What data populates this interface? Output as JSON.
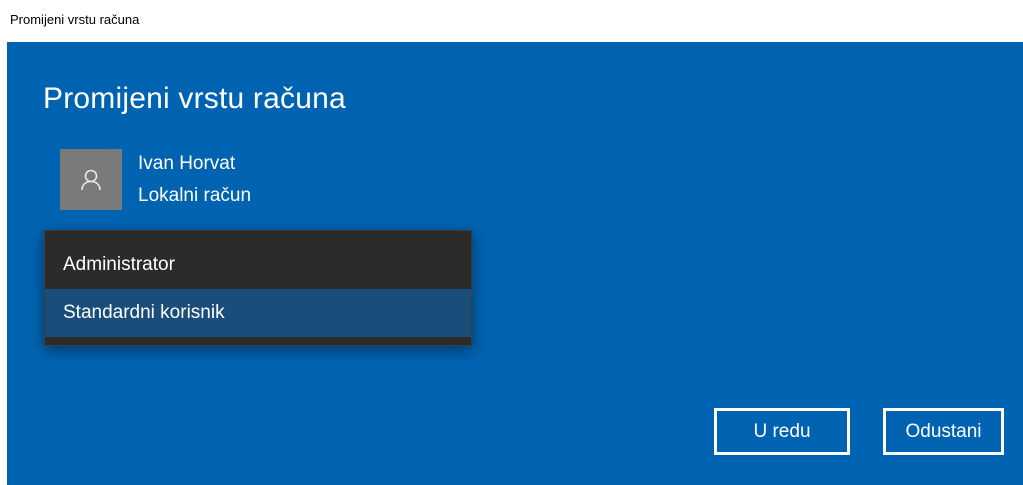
{
  "window": {
    "title": "Promijeni vrstu računa"
  },
  "dialog": {
    "heading": "Promijeni vrstu računa",
    "user": {
      "name": "Ivan Horvat",
      "account_type": "Lokalni račun",
      "avatar_icon": "person-icon"
    },
    "account_type_options": [
      {
        "label": "Administrator",
        "selected": false
      },
      {
        "label": "Standardni korisnik",
        "selected": true
      }
    ],
    "buttons": {
      "ok_label": "U redu",
      "cancel_label": "Odustani"
    }
  },
  "colors": {
    "dialog_bg": "#0063b1",
    "dropdown_bg": "#2b2b2b",
    "selected_option_bg": "#1a4e7a",
    "avatar_bg": "#7a7a7a"
  }
}
